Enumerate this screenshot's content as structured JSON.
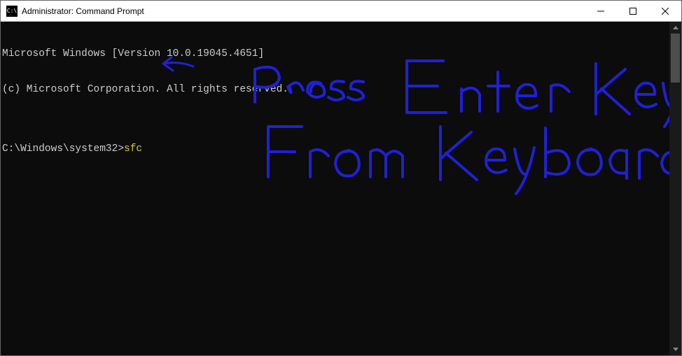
{
  "window": {
    "title": "Administrator: Command Prompt",
    "icon_label": "C:\\"
  },
  "terminal": {
    "line1": "Microsoft Windows [Version 10.0.19045.4651]",
    "line2": "(c) Microsoft Corporation. All rights reserved.",
    "blank": "",
    "prompt": "C:\\Windows\\system32>",
    "command": "sfc"
  },
  "annotation": {
    "text_line1": "Press Enter Key",
    "text_line2": "From Keyboard",
    "color": "#2020d8"
  }
}
